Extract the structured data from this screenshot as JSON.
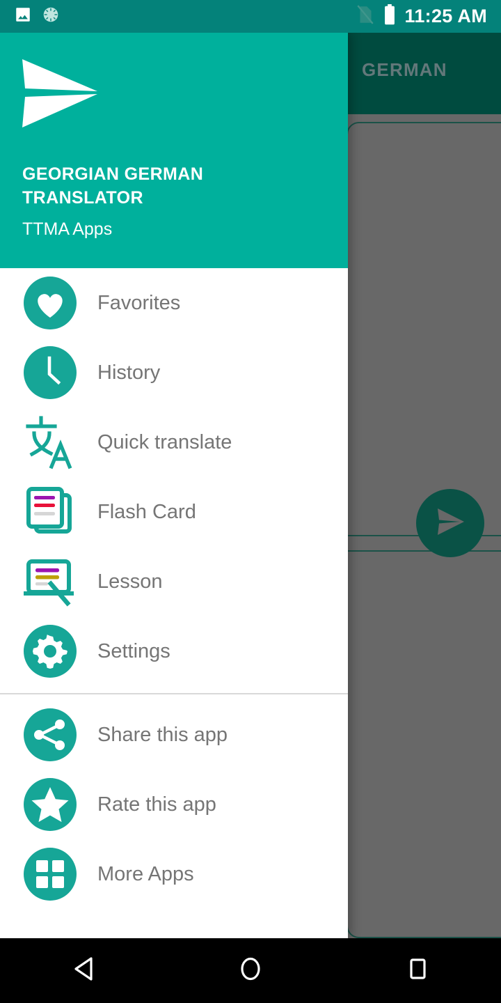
{
  "status_bar": {
    "time": "11:25 AM",
    "left_icons": [
      {
        "name": "photo-icon",
        "glyph": "image"
      },
      {
        "name": "sync-progress-icon",
        "glyph": "spinner"
      }
    ],
    "right_icons": [
      {
        "name": "no-sim-signal-icon",
        "glyph": "signal-off"
      },
      {
        "name": "battery-icon",
        "glyph": "battery-full"
      }
    ],
    "background_color": "#04827a"
  },
  "background_app": {
    "appbar_title": "GERMAN",
    "appbar_color": "#004b3f",
    "scrim_color": "#686868",
    "fab": {
      "name": "send-fab",
      "icon": "send-icon",
      "color": "#0a5246"
    }
  },
  "drawer": {
    "header": {
      "logo_icon": "send-paper-plane-logo",
      "title": "GEORGIAN GERMAN TRANSLATOR",
      "subtitle": "TTMA Apps",
      "background_color": "#00b09c",
      "text_color": "#ffffff"
    },
    "accent_color": "#16a697",
    "label_color": "#757575",
    "primary_items": [
      {
        "label": "Favorites",
        "icon": "heart-icon",
        "style": "filled-circle"
      },
      {
        "label": "History",
        "icon": "clock-icon",
        "style": "filled-circle"
      },
      {
        "label": "Quick translate",
        "icon": "translate-icon",
        "style": "glyph"
      },
      {
        "label": "Flash Card",
        "icon": "flash-card-icon",
        "style": "outline"
      },
      {
        "label": "Lesson",
        "icon": "lesson-board-icon",
        "style": "outline"
      },
      {
        "label": "Settings",
        "icon": "gear-icon",
        "style": "filled-circle"
      }
    ],
    "secondary_items": [
      {
        "label": "Share this app",
        "icon": "share-icon",
        "style": "filled-circle"
      },
      {
        "label": "Rate this app",
        "icon": "star-icon",
        "style": "filled-circle"
      },
      {
        "label": "More Apps",
        "icon": "grid-apps-icon",
        "style": "filled-circle"
      }
    ]
  },
  "navigation_bar": {
    "buttons": [
      {
        "label": "Back",
        "icon": "back-triangle-icon"
      },
      {
        "label": "Home",
        "icon": "home-circle-icon"
      },
      {
        "label": "Recents",
        "icon": "recents-square-icon"
      }
    ],
    "background_color": "#000000"
  }
}
